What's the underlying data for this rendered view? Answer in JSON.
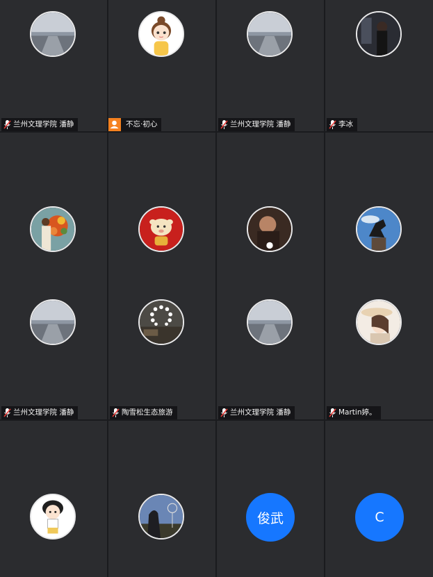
{
  "tiles": [
    {
      "name": "兰州文理学院 潘静"
    },
    {
      "name": "不忘·初心"
    },
    {
      "name": "兰州文理学院 潘静"
    },
    {
      "name": "李冰"
    },
    {
      "name": "兰州文理学院 潘静"
    },
    {
      "name": "陶雪松生态旅游"
    },
    {
      "name": "兰州文理学院 潘静"
    },
    {
      "name": "Martin婷。"
    },
    {
      "initials": "俊武"
    },
    {
      "initials": "C"
    }
  ],
  "colors": {
    "tile_bg": "#2b2c2f",
    "accent_blue": "#1677ff",
    "mic_red": "#e53935",
    "badge_orange": "#f5811f"
  }
}
